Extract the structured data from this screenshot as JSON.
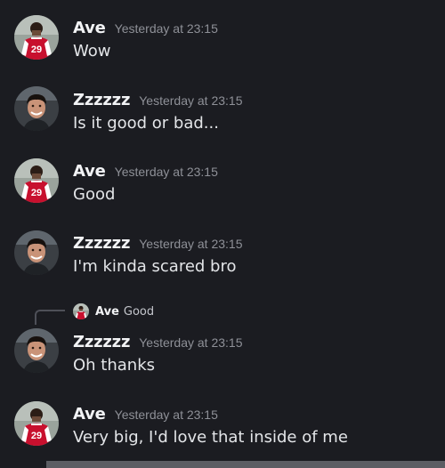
{
  "messages": [
    {
      "username": "Ave",
      "timestamp": "Yesterday at 23:15",
      "content": "Wow",
      "avatar": "ave"
    },
    {
      "username": "Zzzzzz",
      "timestamp": "Yesterday at 23:15",
      "content": "Is it good or bad...",
      "avatar": "zzz"
    },
    {
      "username": "Ave",
      "timestamp": "Yesterday at 23:15",
      "content": "Good",
      "avatar": "ave"
    },
    {
      "username": "Zzzzzz",
      "timestamp": "Yesterday at 23:15",
      "content": "I'm kinda scared bro",
      "avatar": "zzz"
    },
    {
      "username": "Zzzzzz",
      "timestamp": "Yesterday at 23:15",
      "content": "Oh thanks",
      "avatar": "zzz",
      "reply": {
        "username": "Ave",
        "content": "Good"
      }
    },
    {
      "username": "Ave",
      "timestamp": "Yesterday at 23:15",
      "content": "Very big, I'd love that inside of me",
      "avatar": "ave"
    }
  ],
  "avatars": {
    "ave": {
      "desc": "football-player-avatar",
      "jersey_number": "29",
      "jersey_color": "#c8102e"
    },
    "zzz": {
      "desc": "smiling-man-avatar"
    }
  },
  "colors": {
    "background": "#1b1c21",
    "username": "#f2f3f5",
    "timestamp": "#8e9097",
    "text": "#e3e5e8"
  }
}
